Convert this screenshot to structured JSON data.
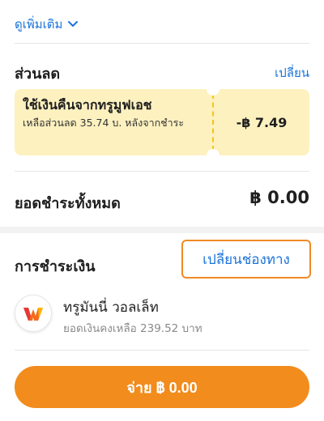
{
  "see_more": {
    "label": "ดูเพิ่มเติม",
    "icon": "chevron-down-icon"
  },
  "discount": {
    "title": "ส่วนลด",
    "change_label": "เปลี่ยน",
    "coupon": {
      "title": "ใช้เงินคืนจากทรูมูฟเอช",
      "description": "เหลือส่วนลด 35.74 บ. หลังจากชำระ",
      "amount": "-฿ 7.49"
    }
  },
  "total": {
    "label": "ยอดชำระทั้งหมด",
    "value": "฿ 0.00"
  },
  "payment": {
    "label": "การชำระเงิน",
    "change_method_label": "เปลี่ยนช่องทาง",
    "method": {
      "name": "ทรูมันนี่ วอลเล็ท",
      "balance": "ยอดเงินคงเหลือ 239.52 บาท",
      "icon": "truemoney-wallet-icon"
    }
  },
  "pay_button": {
    "label": "จ่าย ฿ 0.00"
  },
  "colors": {
    "accent_blue": "#1a73d9",
    "primary_orange": "#f28c1c",
    "highlight_outline": "#f08a24",
    "coupon_bg": "#fdf1c0",
    "coupon_dash": "#f5c518"
  }
}
